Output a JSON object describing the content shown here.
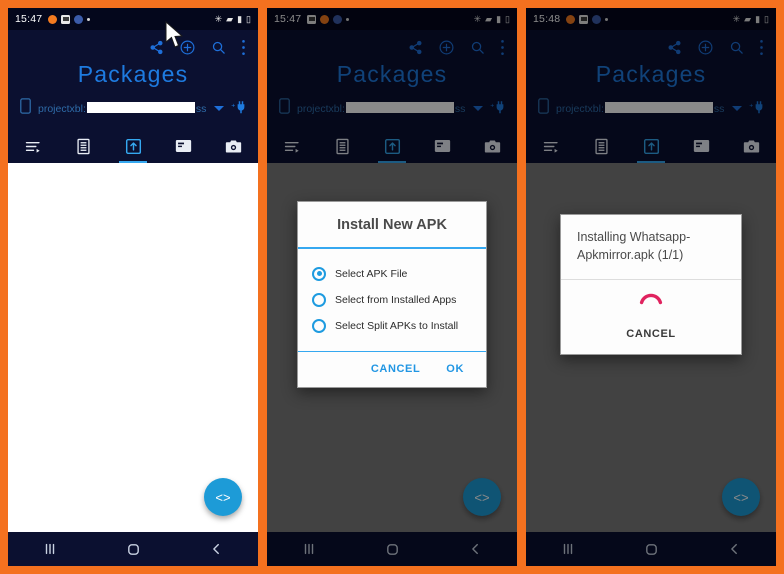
{
  "panels": [
    {
      "id": "panel-initial",
      "statusbar": {
        "time": "15:47"
      },
      "appbar": {
        "title": "Packages",
        "actions": [
          "share-icon",
          "add-circle-icon",
          "search-icon",
          "overflow-menu-icon"
        ]
      },
      "device": {
        "name_prefix": "projectxbl:",
        "name_suffix": "ss.",
        "redacted": true
      },
      "tabs": [
        {
          "name": "logs",
          "active": false
        },
        {
          "name": "files",
          "active": false
        },
        {
          "name": "install",
          "active": true
        },
        {
          "name": "cards",
          "active": false
        },
        {
          "name": "screenshot",
          "active": false
        }
      ],
      "fab": {
        "label": "<>"
      },
      "nav": {
        "recents": "|||",
        "home": "O",
        "back": "<"
      },
      "dimmed": false,
      "cursor": true,
      "dialog": null
    },
    {
      "id": "panel-install-dialog",
      "statusbar": {
        "time": "15:47"
      },
      "appbar": {
        "title": "Packages",
        "actions": [
          "share-icon",
          "add-circle-icon",
          "search-icon",
          "overflow-menu-icon"
        ]
      },
      "device": {
        "name_prefix": "projectxbl:",
        "name_suffix": "ss.",
        "redacted": true
      },
      "tabs": [
        {
          "name": "logs",
          "active": false
        },
        {
          "name": "files",
          "active": false
        },
        {
          "name": "install",
          "active": true
        },
        {
          "name": "cards",
          "active": false
        },
        {
          "name": "screenshot",
          "active": false
        }
      ],
      "fab": {
        "label": "<>"
      },
      "nav": {
        "recents": "|||",
        "home": "O",
        "back": "<"
      },
      "dimmed": true,
      "cursor": false,
      "dialog": {
        "kind": "apk-picker",
        "title": "Install New APK",
        "options": [
          {
            "label": "Select APK File",
            "selected": true
          },
          {
            "label": "Select from Installed Apps",
            "selected": false
          },
          {
            "label": "Select Split APKs to Install",
            "selected": false
          }
        ],
        "cancel_label": "CANCEL",
        "ok_label": "OK"
      }
    },
    {
      "id": "panel-installing",
      "statusbar": {
        "time": "15:48"
      },
      "appbar": {
        "title": "Packages",
        "actions": [
          "share-icon",
          "add-circle-icon",
          "search-icon",
          "overflow-menu-icon"
        ]
      },
      "device": {
        "name_prefix": "projectxbl:",
        "name_suffix": "ss.",
        "redacted": true
      },
      "tabs": [
        {
          "name": "logs",
          "active": false
        },
        {
          "name": "files",
          "active": false
        },
        {
          "name": "install",
          "active": true
        },
        {
          "name": "cards",
          "active": false
        },
        {
          "name": "screenshot",
          "active": false
        }
      ],
      "fab": {
        "label": "<>"
      },
      "nav": {
        "recents": "|||",
        "home": "O",
        "back": "<"
      },
      "dimmed": true,
      "cursor": false,
      "dialog": {
        "kind": "progress",
        "message": "Installing Whatsapp-Apkmirror.apk (1/1)",
        "cancel_label": "CANCEL",
        "spinner_color": "#E0235F"
      }
    }
  ],
  "colors": {
    "frame_orange": "#F4711F",
    "app_navy": "#0B1030",
    "status_navy": "#04071C",
    "accent_blue": "#1E7BE0",
    "tab_active": "#35A8F0",
    "fab_blue": "#1D9BD7",
    "dialog_link": "#2196E3",
    "spinner_pink": "#E0235F"
  }
}
